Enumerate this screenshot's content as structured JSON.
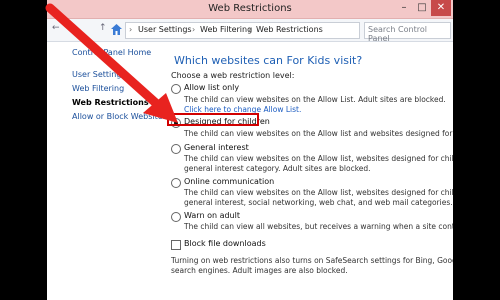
{
  "window": {
    "title": "Web Restrictions",
    "controls": {
      "minimize": "–",
      "maximize": "□",
      "close": "✕"
    }
  },
  "address_bar": {
    "back": "←",
    "forward": "→",
    "up": "↑",
    "home_icon": "home-icon",
    "crumbs": [
      "User Settings",
      "Web Filtering",
      "Web Restrictions"
    ],
    "separator": "›",
    "search_placeholder": "Search Control Panel"
  },
  "sidebar": {
    "home": "Control Panel Home",
    "items": [
      {
        "label": "User Settings",
        "active": false
      },
      {
        "label": "Web Filtering",
        "active": false
      },
      {
        "label": "Web Restrictions",
        "active": true
      },
      {
        "label": "Allow or Block Websites",
        "active": false
      }
    ]
  },
  "main": {
    "heading": "Which websites can For Kids visit?",
    "subheading": "Choose a web restriction level:",
    "options": [
      {
        "label": "Allow list only",
        "selected": false,
        "desc": [
          "The child can view websites on the Allow List. Adult sites are blocked."
        ],
        "link": "Click here to change Allow List."
      },
      {
        "label": "Designed for children",
        "selected": true,
        "desc": [
          "The child can view websites on the Allow list and websites designed for children. Adu"
        ]
      },
      {
        "label": "General interest",
        "selected": false,
        "desc": [
          "The child can view websites on the Allow list, websites designed for children, and we",
          "general interest category. Adult sites are blocked."
        ]
      },
      {
        "label": "Online communication",
        "selected": false,
        "desc": [
          "The child can view websites on the Allow list, websites designed for children, and we",
          "general interest, social networking, web chat, and web mail categories. Adult sites ar"
        ]
      },
      {
        "label": "Warn on adult",
        "selected": false,
        "desc": [
          "The child can view all websites, but receives a warning when a site contains suspecte"
        ]
      }
    ],
    "block_downloads": {
      "label": "Block file downloads",
      "checked": false
    },
    "footer": [
      "Turning on web restrictions also turns on SafeSearch settings for Bing, Google, Yahoo! and",
      "search engines. Adult images are also blocked."
    ]
  },
  "colors": {
    "accent": "#1e5fb4",
    "highlight": "#d10000",
    "arrow": "#e8231f"
  }
}
